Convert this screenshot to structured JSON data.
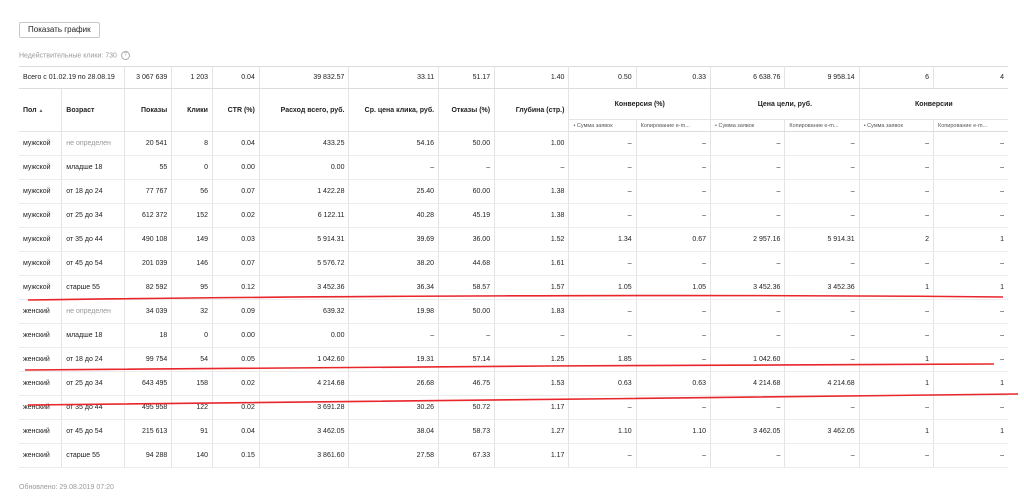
{
  "toolbar": {
    "show_chart_label": "Показать график"
  },
  "invalid_clicks": {
    "label": "Недействительные клики: 730",
    "icon": "help-circle-icon"
  },
  "total": {
    "label": "Всего с 01.02.19 по 28.08.19",
    "values": [
      "3 067 639",
      "1 203",
      "0.04",
      "39 832.57",
      "33.11",
      "51.17",
      "1.40",
      "0.50",
      "0.33",
      "6 638.76",
      "9 958.14",
      "6",
      "4"
    ]
  },
  "headers": {
    "gender": "Пол",
    "sort_icon": "▲",
    "age": "Возраст",
    "impressions": "Показы",
    "clicks": "Клики",
    "ctr": "CTR (%)",
    "spend": "Расход всего, руб.",
    "cpc": "Ср. цена клика, руб.",
    "bounce": "Отказы (%)",
    "depth": "Глубина (стр.)",
    "conversion_pct": "Конверсия (%)",
    "goal_price": "Цена цели, руб.",
    "conversions": "Конверсии",
    "sub_a": "• Сумма заявок",
    "sub_b": "Копирование e-m..."
  },
  "rows": [
    [
      "мужской",
      "не определен",
      "20 541",
      "8",
      "0.04",
      "433.25",
      "54.16",
      "50.00",
      "1.00",
      "–",
      "–",
      "–",
      "–",
      "–",
      "–"
    ],
    [
      "мужской",
      "младше 18",
      "55",
      "0",
      "0.00",
      "0.00",
      "–",
      "–",
      "–",
      "–",
      "–",
      "–",
      "–",
      "–",
      "–"
    ],
    [
      "мужской",
      "от 18 до 24",
      "77 767",
      "56",
      "0.07",
      "1 422.28",
      "25.40",
      "60.00",
      "1.38",
      "–",
      "–",
      "–",
      "–",
      "–",
      "–"
    ],
    [
      "мужской",
      "от 25 до 34",
      "612 372",
      "152",
      "0.02",
      "6 122.11",
      "40.28",
      "45.19",
      "1.38",
      "–",
      "–",
      "–",
      "–",
      "–",
      "–"
    ],
    [
      "мужской",
      "от 35 до 44",
      "490 108",
      "149",
      "0.03",
      "5 914.31",
      "39.69",
      "36.00",
      "1.52",
      "1.34",
      "0.67",
      "2 957.16",
      "5 914.31",
      "2",
      "1"
    ],
    [
      "мужской",
      "от 45 до 54",
      "201 039",
      "146",
      "0.07",
      "5 576.72",
      "38.20",
      "44.68",
      "1.61",
      "–",
      "–",
      "–",
      "–",
      "–",
      "–"
    ],
    [
      "мужской",
      "старше 55",
      "82 592",
      "95",
      "0.12",
      "3 452.36",
      "36.34",
      "58.57",
      "1.57",
      "1.05",
      "1.05",
      "3 452.36",
      "3 452.36",
      "1",
      "1"
    ],
    [
      "женский",
      "не определен",
      "34 039",
      "32",
      "0.09",
      "639.32",
      "19.98",
      "50.00",
      "1.83",
      "–",
      "–",
      "–",
      "–",
      "–",
      "–"
    ],
    [
      "женский",
      "младше 18",
      "18",
      "0",
      "0.00",
      "0.00",
      "–",
      "–",
      "–",
      "–",
      "–",
      "–",
      "–",
      "–",
      "–"
    ],
    [
      "женский",
      "от 18 до 24",
      "99 754",
      "54",
      "0.05",
      "1 042.60",
      "19.31",
      "57.14",
      "1.25",
      "1.85",
      "–",
      "1 042.60",
      "–",
      "1",
      "–"
    ],
    [
      "женский",
      "от 25 до 34",
      "643 495",
      "158",
      "0.02",
      "4 214.68",
      "26.68",
      "46.75",
      "1.53",
      "0.63",
      "0.63",
      "4 214.68",
      "4 214.68",
      "1",
      "1"
    ],
    [
      "женский",
      "от 35 до 44",
      "495 958",
      "122",
      "0.02",
      "3 691.28",
      "30.26",
      "50.72",
      "1.17",
      "–",
      "–",
      "–",
      "–",
      "–",
      "–"
    ],
    [
      "женский",
      "от 45 до 54",
      "215 613",
      "91",
      "0.04",
      "3 462.05",
      "38.04",
      "58.73",
      "1.27",
      "1.10",
      "1.10",
      "3 462.05",
      "3 462.05",
      "1",
      "1"
    ],
    [
      "женский",
      "старше 55",
      "94 288",
      "140",
      "0.15",
      "3 861.60",
      "27.58",
      "67.33",
      "1.17",
      "–",
      "–",
      "–",
      "–",
      "–",
      "–"
    ]
  ],
  "footer": {
    "updated": "Обновлено: 29.08.2019 07:20"
  },
  "colors": {
    "annotation": "#e8262b",
    "muted": "#999999"
  }
}
